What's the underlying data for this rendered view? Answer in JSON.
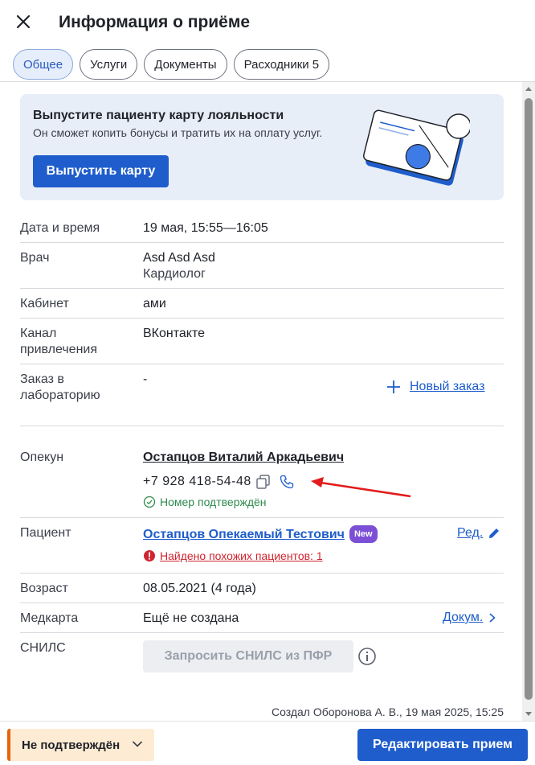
{
  "header": {
    "title": "Информация о приёме"
  },
  "tabs": [
    {
      "label": "Общее",
      "active": true
    },
    {
      "label": "Услуги"
    },
    {
      "label": "Документы"
    },
    {
      "label": "Расходники 5"
    }
  ],
  "banner": {
    "title": "Выпустите пациенту карту лояльности",
    "subtitle": "Он сможет копить бонусы и тратить их на оплату услуг.",
    "button": "Выпустить карту"
  },
  "details": {
    "datetime": {
      "label": "Дата и время",
      "value": "19 мая, 15:55—16:05"
    },
    "doctor": {
      "label": "Врач",
      "name": "Asd Asd Asd",
      "specialty": "Кардиолог"
    },
    "cabinet": {
      "label": "Кабинет",
      "value": "ами"
    },
    "channel": {
      "label": "Канал привлечения",
      "value": "ВКонтакте"
    },
    "lab": {
      "label": "Заказ в лабораторию",
      "value": "-",
      "new_order": "Новый заказ"
    },
    "guardian": {
      "label": "Опекун",
      "name": "Остапцов Виталий Аркадьевич",
      "phone": "+7 928 418-54-48",
      "confirmed": "Номер подтверждён"
    },
    "patient": {
      "label": "Пациент",
      "name": "Остапцов Опекаемый Тестович",
      "badge": "New",
      "edit": "Ред.",
      "warning": "Найдено похожих пациентов: 1"
    },
    "age": {
      "label": "Возраст",
      "value": "08.05.2021 (4 года)"
    },
    "medcard": {
      "label": "Медкарта",
      "value": "Ещё не создана",
      "docs": "Докум."
    },
    "snils": {
      "label": "СНИЛС",
      "button": "Запросить СНИЛС из ПФР"
    }
  },
  "created": "Создал Оборонова А. В., 19 мая 2025, 15:25",
  "footer": {
    "status": "Не подтверждён",
    "edit": "Редактировать прием"
  },
  "colors": {
    "accent": "#1f5dcc",
    "status_orange": "#e4650e",
    "confirmed_green": "#2e8a4e",
    "warning_red": "#d1242f",
    "badge_purple": "#7b4fd6"
  }
}
